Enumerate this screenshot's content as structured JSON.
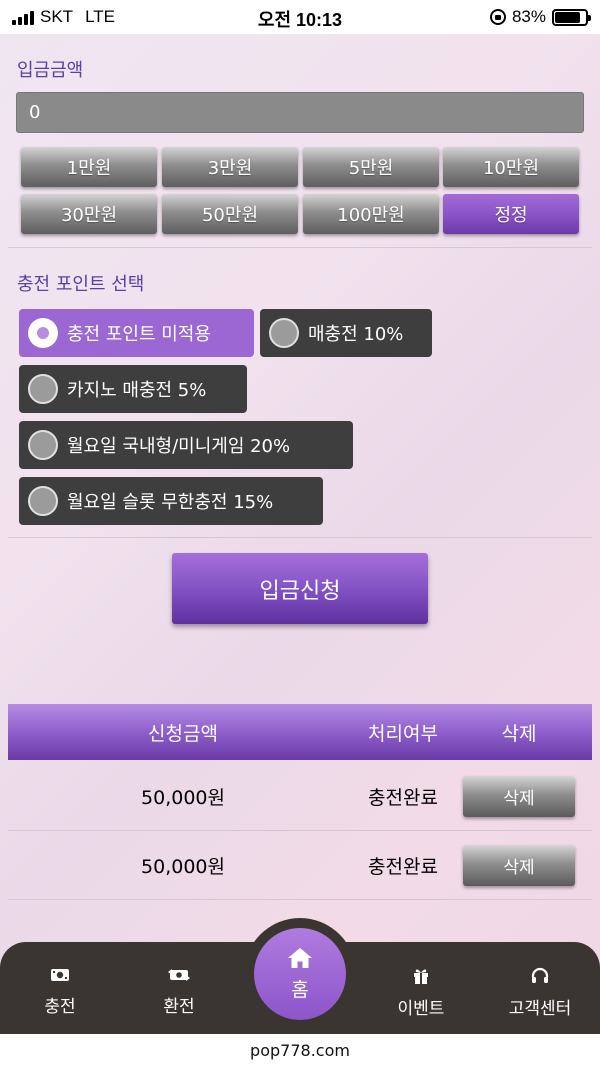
{
  "status_bar": {
    "carrier": "SKT",
    "network": "LTE",
    "time": "오전 10:13",
    "battery": "83%",
    "battery_level": 0.83
  },
  "deposit": {
    "title": "입금금액",
    "amount_value": "0",
    "amount_buttons": [
      "1만원",
      "3만원",
      "5만원",
      "10만원",
      "30만원",
      "50만원",
      "100만원",
      "정정"
    ]
  },
  "points": {
    "title": "충전 포인트 선택",
    "options": [
      {
        "label": "충전 포인트 미적용",
        "selected": true
      },
      {
        "label": "매충전 10%",
        "selected": false
      },
      {
        "label": "카지노 매충전 5%",
        "selected": false
      },
      {
        "label": "월요일 국내형/미니게임 20%",
        "selected": false
      },
      {
        "label": "월요일 슬롯 무한충전 15%",
        "selected": false
      }
    ]
  },
  "submit_label": "입금신청",
  "table": {
    "headers": [
      "신청금액",
      "처리여부",
      "삭제"
    ],
    "rows": [
      {
        "amount": "50,000원",
        "status": "충전완료",
        "delete_label": "삭제"
      },
      {
        "amount": "50,000원",
        "status": "충전완료",
        "delete_label": "삭제"
      }
    ]
  },
  "bottom_nav": {
    "items": [
      {
        "label": "충전",
        "icon": "money-icon"
      },
      {
        "label": "환전",
        "icon": "exchange-icon"
      },
      {
        "label": "홈",
        "icon": "home-icon"
      },
      {
        "label": "이벤트",
        "icon": "gift-icon"
      },
      {
        "label": "고객센터",
        "icon": "headset-icon"
      }
    ]
  },
  "footer_url": "pop778.com",
  "colors": {
    "accent_purple": "#8a55c8",
    "dark_option": "#3e3e3e",
    "nav_bg": "#3a3530"
  }
}
